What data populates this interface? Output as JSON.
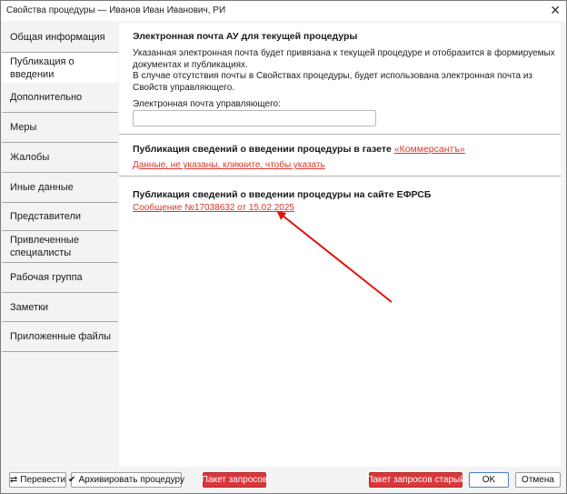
{
  "window": {
    "title": "Свойства процедуры — Иванов Иван Иванович, РИ",
    "close_glyph": "✕"
  },
  "sidebar": {
    "items": [
      {
        "label": "Общая информация"
      },
      {
        "label": "Публикация о введении"
      },
      {
        "label": "Дополнительно"
      },
      {
        "label": "Меры"
      },
      {
        "label": "Жалобы"
      },
      {
        "label": "Иные данные"
      },
      {
        "label": "Представители"
      },
      {
        "label": "Привлеченные специалисты"
      },
      {
        "label": "Рабочая группа"
      },
      {
        "label": "Заметки"
      },
      {
        "label": "Приложенные файлы"
      }
    ],
    "active_index": 1
  },
  "email_section": {
    "title": "Электронная почта АУ для текущей процедуры",
    "desc_line1": "Указанная электронная почта будет привязана к текущей процедуре и отобразится в формируемых документах и публикациях.",
    "desc_line2": "В случае отсутствия почты в Свойствах процедуры, будет использована электронная почта из Свойств управляющего.",
    "field_label": "Электронная почта управляющего:",
    "field_value": ""
  },
  "newspaper_section": {
    "title_prefix": "Публикация сведений о введении процедуры в газете ",
    "newspaper_link": "«Коммерсантъ»",
    "missing_link": "Данные, не указаны, кликните, чтобы указать"
  },
  "efrsb_section": {
    "title": "Публикация сведений о введении процедуры на сайте ЕФРСБ",
    "message_link": "Сообщение №17038632 от 15.02.2025"
  },
  "footer": {
    "translate_label": "Перевести",
    "archive_label": "Архивировать процедуру",
    "package_label": "Пакет запросов",
    "old_package_label": "Пакет запросов старый",
    "ok_label": "OK",
    "cancel_label": "Отмена"
  },
  "colors": {
    "accent_red": "#d8373b",
    "link_red": "#d9362b",
    "annotation_arrow": "#e3120b"
  },
  "icons": {
    "translate": "swap-arrows-icon",
    "archive": "checkmark-icon",
    "close": "close-icon"
  }
}
